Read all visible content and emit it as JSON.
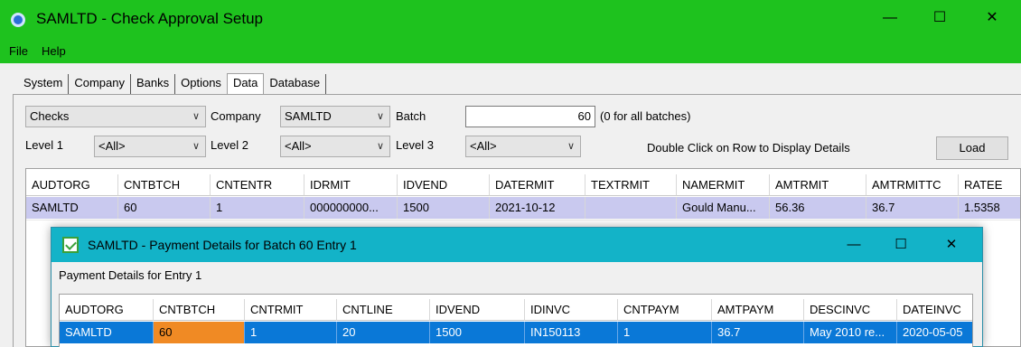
{
  "window": {
    "title": "SAMLTD - Check Approval Setup",
    "controls": {
      "minimize": "—",
      "maximize": "☐",
      "close": "✕"
    }
  },
  "menu": [
    {
      "label": "File",
      "icon": "none"
    },
    {
      "label": "Help",
      "icon": "none"
    }
  ],
  "tabs": [
    "System",
    "Company",
    "Banks",
    "Options",
    "Data",
    "Database"
  ],
  "active_tab": "Data",
  "filters": {
    "type_value": "Checks",
    "company_label": "Company",
    "company_value": "SAMLTD",
    "batch_label": "Batch",
    "batch_value": "60",
    "batch_hint": "(0 for all batches)",
    "level1_label": "Level 1",
    "level1_value": "<All>",
    "level2_label": "Level 2",
    "level2_value": "<All>",
    "level3_label": "Level 3",
    "level3_value": "<All>",
    "hint": "Double Click on Row to Display Details",
    "load_label": "Load"
  },
  "grid": {
    "columns": [
      "AUDTORG",
      "CNTBTCH",
      "CNTENTR",
      "IDRMIT",
      "IDVEND",
      "DATERMIT",
      "TEXTRMIT",
      "NAMERMIT",
      "AMTRMIT",
      "AMTRMITTC",
      "RATEE"
    ],
    "rows": [
      [
        "SAMLTD",
        "60",
        "1",
        "000000000...",
        "1500",
        "2021-10-12",
        "",
        "Gould Manu...",
        "56.36",
        "36.7",
        "1.5358"
      ]
    ]
  },
  "dialog": {
    "title": "SAMLTD - Payment Details for Batch 60 Entry 1",
    "subtitle": "Payment Details for Entry 1",
    "controls": {
      "minimize": "—",
      "maximize": "☐",
      "close": "✕"
    },
    "columns": [
      "AUDTORG",
      "CNTBTCH",
      "CNTRMIT",
      "CNTLINE",
      "IDVEND",
      "IDINVC",
      "CNTPAYM",
      "AMTPAYM",
      "DESCINVC",
      "DATEINVC"
    ],
    "rows": [
      [
        "SAMLTD",
        "60",
        "1",
        "20",
        "1500",
        "IN150113",
        "1",
        "36.7",
        "May 2010 re...",
        "2020-05-05"
      ]
    ]
  },
  "colors": {
    "titlebar": "#1ec21e",
    "dialog_titlebar": "#13b3c8",
    "selected_row": "#c9c9ef",
    "dialog_selected_row": "#0a78d7",
    "current_cell": "#f08a24"
  }
}
